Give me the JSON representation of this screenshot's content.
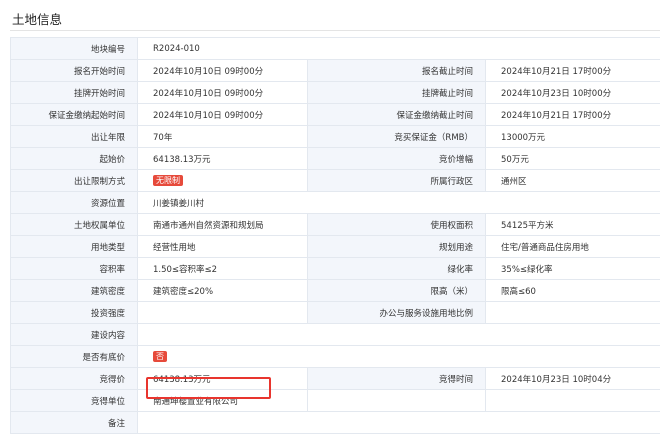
{
  "section_title": "土地信息",
  "rows": [
    {
      "l1": "地块编号",
      "v1": "R2024-010"
    },
    {
      "l1": "报名开始时间",
      "v1": "2024年10月10日 09时00分",
      "l2": "报名截止时间",
      "v2": "2024年10月21日 17时00分"
    },
    {
      "l1": "挂牌开始时间",
      "v1": "2024年10月10日 09时00分",
      "l2": "挂牌截止时间",
      "v2": "2024年10月23日 10时00分"
    },
    {
      "l1": "保证金缴纳起始时间",
      "v1": "2024年10月10日 09时00分",
      "l2": "保证金缴纳截止时间",
      "v2": "2024年10月21日 17时00分"
    },
    {
      "l1": "出让年限",
      "v1": "70年",
      "l2": "竞买保证金（RMB）",
      "v2": "13000万元"
    },
    {
      "l1": "起始价",
      "v1": "64138.13万元",
      "l2": "竞价增幅",
      "v2": "50万元"
    },
    {
      "l1": "出让限制方式",
      "tag1": "无限制",
      "l2": "所属行政区",
      "v2": "通州区"
    },
    {
      "l1": "资源位置",
      "v1": "川姜镇姜川村"
    },
    {
      "l1": "土地权属单位",
      "v1": "南通市通州自然资源和规划局",
      "l2": "使用权面积",
      "v2": "54125平方米"
    },
    {
      "l1": "用地类型",
      "v1": "经营性用地",
      "l2": "规划用途",
      "v2": "住宅/普通商品住房用地"
    },
    {
      "l1": "容积率",
      "v1": "1.50≤容积率≤2",
      "l2": "绿化率",
      "v2": "35%≤绿化率"
    },
    {
      "l1": "建筑密度",
      "v1": "建筑密度≤20%",
      "l2": "限高（米）",
      "v2": "限高≤60"
    },
    {
      "l1": "投资强度",
      "v1": "",
      "l2": "办公与服务设施用地比例",
      "v2": ""
    },
    {
      "l1": "建设内容",
      "v1": ""
    },
    {
      "l1": "是否有底价",
      "tag1": "否"
    },
    {
      "l1": "竞得价",
      "v1": "64138.13万元",
      "l2": "竞得时间",
      "v2": "2024年10月23日 10时04分"
    },
    {
      "l1": "竞得单位",
      "v1": "南通坤樱置业有限公司",
      "l2": "",
      "v2": ""
    },
    {
      "l1": "备注",
      "v1": ""
    }
  ],
  "colors": {
    "label_bg": "#f3f6fb",
    "border": "#e3e8ef",
    "tag": "#e64a3b",
    "highlight": "#e8352e"
  }
}
